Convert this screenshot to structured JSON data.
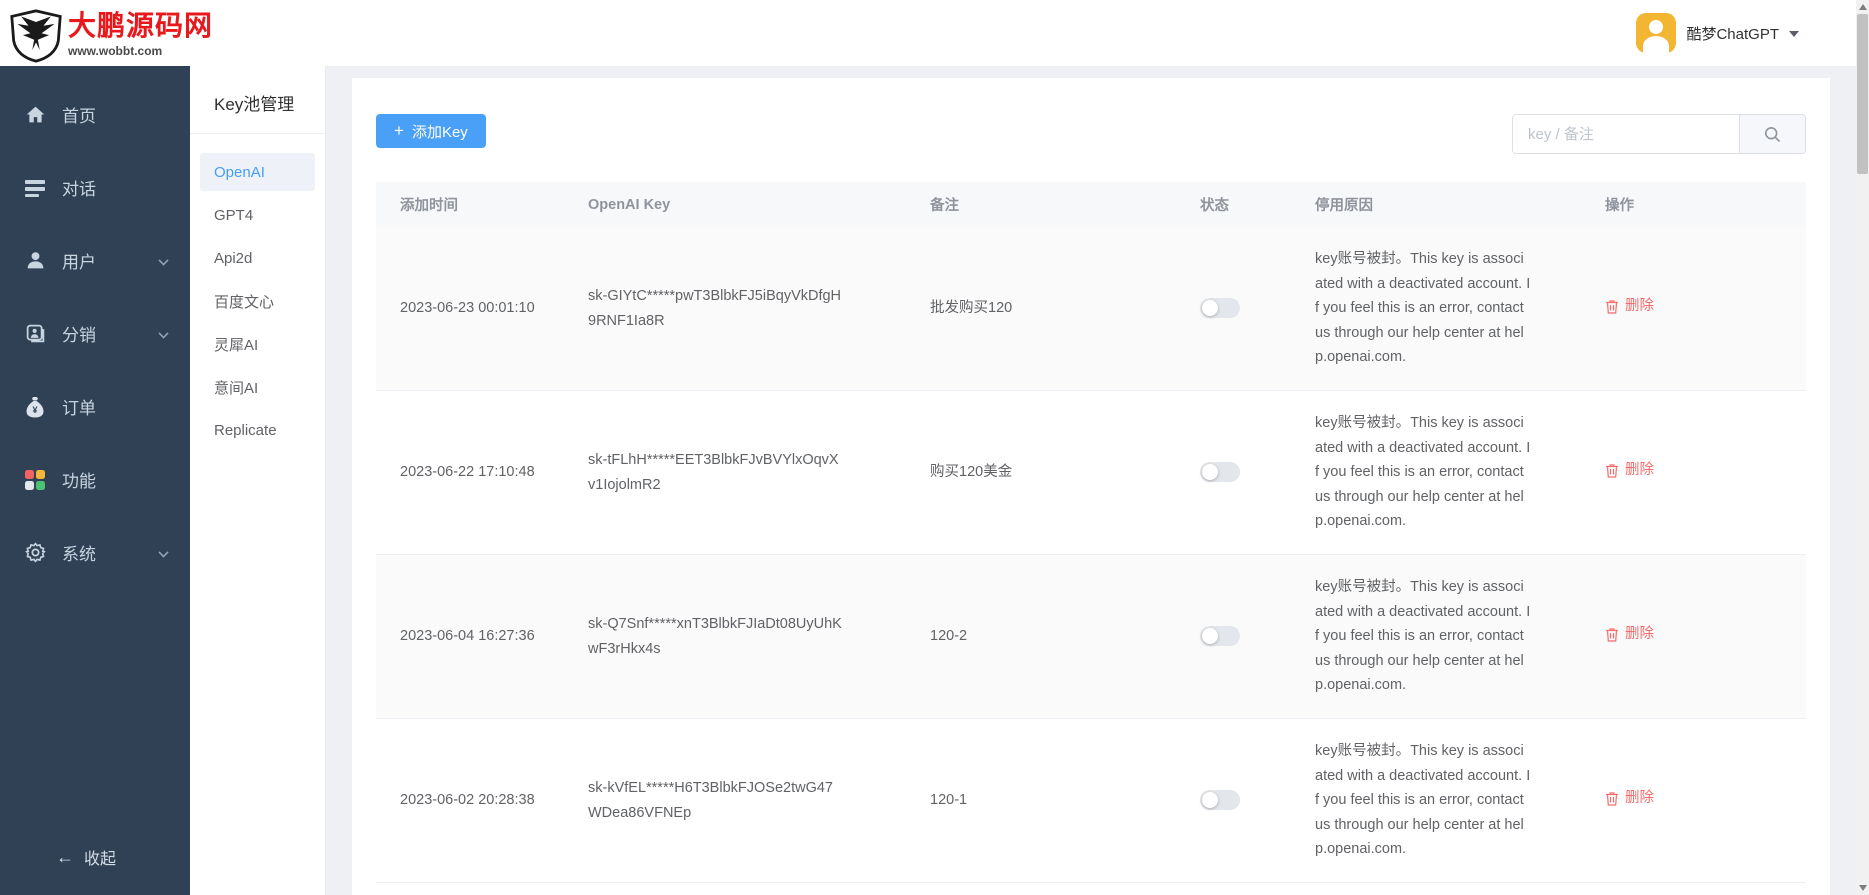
{
  "header": {
    "logo_title": "大鹏源码网",
    "logo_subtitle": "www.wobbt.com",
    "user_name": "酷梦ChatGPT"
  },
  "colors": {
    "brand_red": "#e8191c",
    "accent_blue": "#4aa0f6",
    "link_blue": "#459df5",
    "delete_red": "#f56c6c",
    "avatar_gold": "#f2b632",
    "sidebar_navy": "#304156"
  },
  "sidebar": {
    "items": [
      {
        "label": "首页",
        "icon": "home-icon",
        "expandable": false
      },
      {
        "label": "对话",
        "icon": "chat-lines-icon",
        "expandable": false
      },
      {
        "label": "用户",
        "icon": "user-icon",
        "expandable": true
      },
      {
        "label": "分销",
        "icon": "distribution-icon",
        "expandable": true
      },
      {
        "label": "订单",
        "icon": "money-bag-icon",
        "expandable": false
      },
      {
        "label": "功能",
        "icon": "features-grid-icon",
        "expandable": false
      },
      {
        "label": "系统",
        "icon": "gear-icon",
        "expandable": true
      }
    ],
    "collapse_arrow": "←",
    "collapse_label": "收起"
  },
  "submenu": {
    "title": "Key池管理",
    "items": [
      {
        "label": "OpenAI",
        "active": true
      },
      {
        "label": "GPT4",
        "active": false
      },
      {
        "label": "Api2d",
        "active": false
      },
      {
        "label": "百度文心",
        "active": false
      },
      {
        "label": "灵犀AI",
        "active": false
      },
      {
        "label": "意间AI",
        "active": false
      },
      {
        "label": "Replicate",
        "active": false
      }
    ]
  },
  "toolbar": {
    "add_plus": "+",
    "add_label": "添加Key",
    "search_placeholder": "key / 备注"
  },
  "table": {
    "columns": [
      "添加时间",
      "OpenAI Key",
      "备注",
      "状态",
      "停用原因",
      "操作"
    ],
    "delete_label": "删除",
    "rows": [
      {
        "time": "2023-06-23 00:01:10",
        "key": "sk-GIYtC*****pwT3BlbkFJ5iBqyVkDfgH9RNF1Ia8R",
        "note": "批发购买120",
        "enabled": false,
        "reason": "key账号被封。This key is associated with a deactivated account. If you feel this is an error, contact us through our help center at help.openai.com."
      },
      {
        "time": "2023-06-22 17:10:48",
        "key": "sk-tFLhH*****EET3BlbkFJvBVYlxOqvXv1IojolmR2",
        "note": "购买120美金",
        "enabled": false,
        "reason": "key账号被封。This key is associated with a deactivated account. If you feel this is an error, contact us through our help center at help.openai.com."
      },
      {
        "time": "2023-06-04 16:27:36",
        "key": "sk-Q7Snf*****xnT3BlbkFJIaDt08UyUhKwF3rHkx4s",
        "note": "120-2",
        "enabled": false,
        "reason": "key账号被封。This key is associated with a deactivated account. If you feel this is an error, contact us through our help center at help.openai.com."
      },
      {
        "time": "2023-06-02 20:28:38",
        "key": "sk-kVfEL*****H6T3BlbkFJOSe2twG47WDea86VFNEp",
        "note": "120-1",
        "enabled": false,
        "reason": "key账号被封。This key is associated with a deactivated account. If you feel this is an error, contact us through our help center at help.openai.com."
      }
    ]
  }
}
